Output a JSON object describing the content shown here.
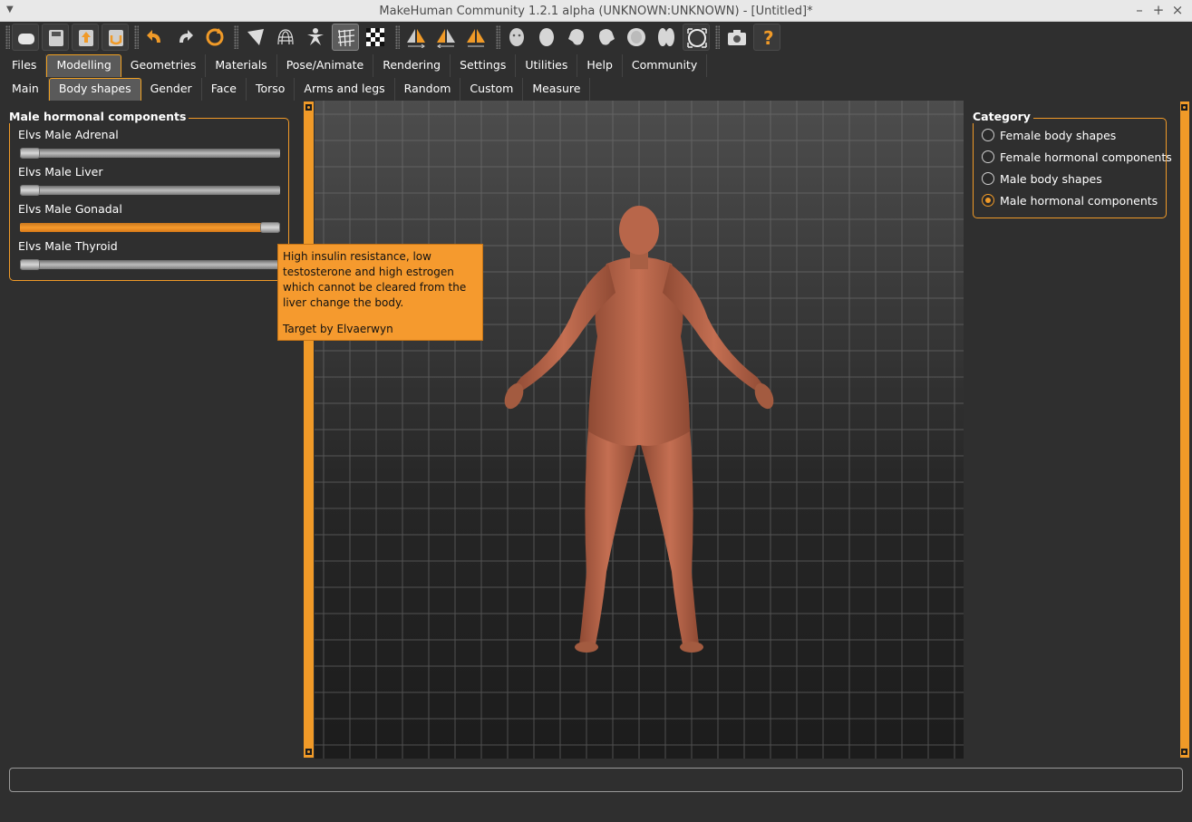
{
  "window": {
    "title": "MakeHuman Community 1.2.1 alpha (UNKNOWN:UNKNOWN) - [Untitled]*",
    "controls": [
      "–",
      "+",
      "×"
    ]
  },
  "toolbar": {
    "icons": [
      "new-icon",
      "save-icon",
      "load-icon",
      "export-icon",
      "undo-icon",
      "redo-icon",
      "reset-icon",
      "smooth-icon",
      "wireframe-icon",
      "pose-icon",
      "grid-icon",
      "background-icon",
      "symmetry-right-icon",
      "symmetry-left-icon",
      "symmetry-icon",
      "front-view-icon",
      "back-view-icon",
      "left-view-icon",
      "right-view-icon",
      "top-view-icon",
      "bottom-view-icon",
      "reset-camera-icon",
      "screenshot-icon",
      "help-icon"
    ]
  },
  "main_tabs": [
    "Files",
    "Modelling",
    "Geometries",
    "Materials",
    "Pose/Animate",
    "Rendering",
    "Settings",
    "Utilities",
    "Help",
    "Community"
  ],
  "sub_tabs": [
    "Main",
    "Body shapes",
    "Gender",
    "Face",
    "Torso",
    "Arms and legs",
    "Random",
    "Custom",
    "Measure"
  ],
  "left_panel": {
    "title": "Male hormonal components",
    "sliders": [
      {
        "label": "Elvs Male Adrenal",
        "value": 0.0
      },
      {
        "label": "Elvs Male Liver",
        "value": 0.0
      },
      {
        "label": "Elvs Male Gonadal",
        "value": 1.0
      },
      {
        "label": "Elvs Male Thyroid",
        "value": 0.0
      }
    ]
  },
  "tooltip": {
    "text": "High insulin resistance, low testosterone and high estrogen which cannot be cleared from the liver change the body.",
    "credit": "Target by Elvaerwyn"
  },
  "right_panel": {
    "title": "Category",
    "options": [
      {
        "label": "Female body shapes",
        "checked": false
      },
      {
        "label": "Female hormonal components",
        "checked": false
      },
      {
        "label": "Male body shapes",
        "checked": false
      },
      {
        "label": "Male hormonal components",
        "checked": true
      }
    ]
  },
  "colors": {
    "accent": "#f09a28",
    "skin": "#b8664a",
    "background": "#2f2f2f"
  },
  "status": {
    "text": ""
  }
}
